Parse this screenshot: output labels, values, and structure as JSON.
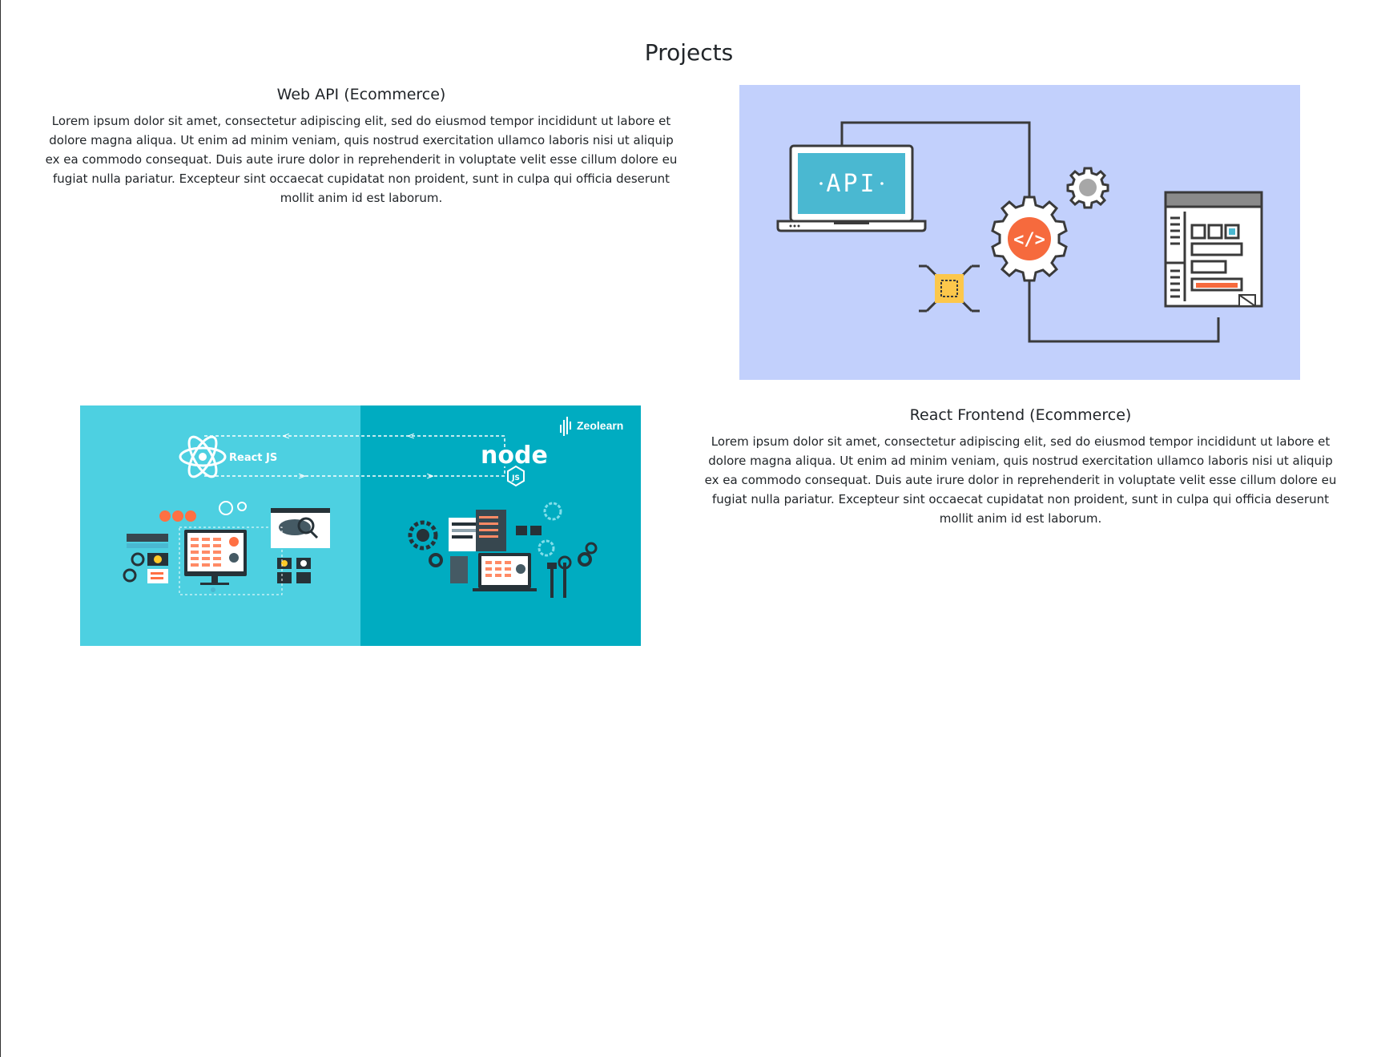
{
  "page": {
    "title": "Projects"
  },
  "projects": [
    {
      "title": "Web API (Ecommerce)",
      "description": "Lorem ipsum dolor sit amet, consectetur adipiscing elit, sed do eiusmod tempor incididunt ut labore et dolore magna aliqua. Ut enim ad minim veniam, quis nostrud exercitation ullamco laboris nisi ut aliquip ex ea commodo consequat. Duis aute irure dolor in reprehenderit in voluptate velit esse cillum dolore eu fugiat nulla pariatur. Excepteur sint occaecat cupidatat non proident, sunt in culpa qui officia deserunt mollit anim id est laborum.",
      "image": {
        "label": "API",
        "icon": "api-illustration"
      }
    },
    {
      "title": "React Frontend (Ecommerce)",
      "description": "Lorem ipsum dolor sit amet, consectetur adipiscing elit, sed do eiusmod tempor incididunt ut labore et dolore magna aliqua. Ut enim ad minim veniam, quis nostrud exercitation ullamco laboris nisi ut aliquip ex ea commodo consequat. Duis aute irure dolor in reprehenderit in voluptate velit esse cillum dolore eu fugiat nulla pariatur. Excepteur sint occaecat cupidatat non proident, sunt in culpa qui officia deserunt mollit anim id est laborum.",
      "image": {
        "left_label": "React JS",
        "right_label": "node",
        "right_badge": "JS",
        "brand": "Zeolearn",
        "brand_tm": "™",
        "icon": "react-node-illustration"
      }
    }
  ],
  "colors": {
    "api_bg": "#c2d0fc",
    "api_screen": "#4ab8d1",
    "api_orange": "#f66a3d",
    "api_yellow": "#fcc74b",
    "line_dark": "#3a3a3a",
    "react_left_bg": "#4dd0e1",
    "react_right_bg": "#00acc1"
  }
}
